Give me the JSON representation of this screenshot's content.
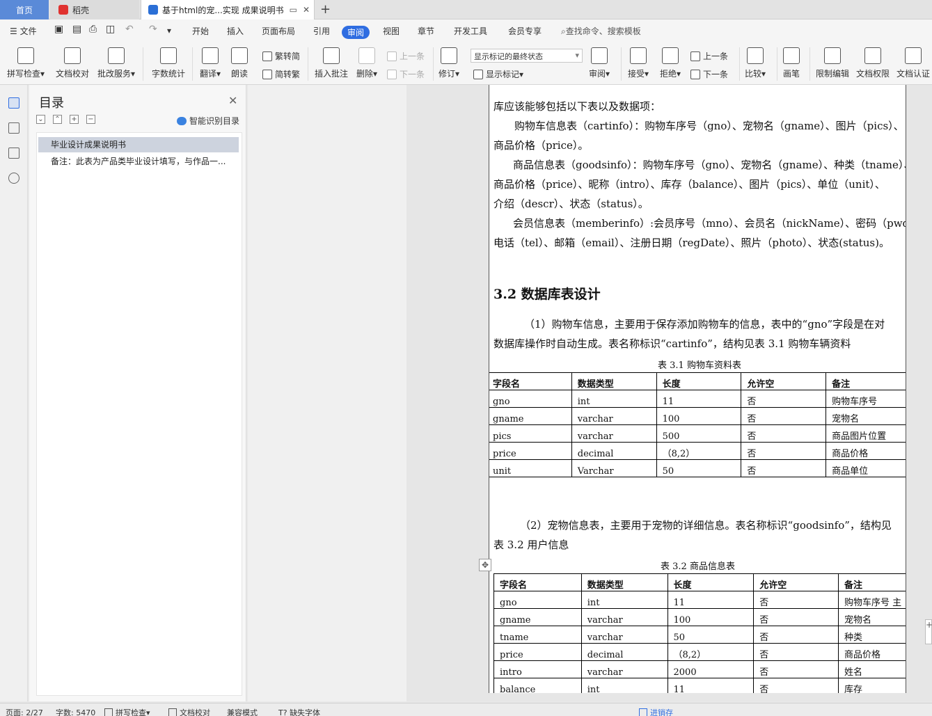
{
  "tabs": {
    "home": "首页",
    "daoke": "稻壳",
    "document": "基于html的宠...实现 成果说明书",
    "add": "+"
  },
  "menu": [
    "文件",
    "开始",
    "插入",
    "页面布局",
    "引用",
    "审阅",
    "视图",
    "章节",
    "开发工具",
    "会员专享"
  ],
  "menu_search": "查找命令、搜索模板",
  "ribbon": {
    "spell_check": "拼写检查",
    "doc_proof": "文档校对",
    "correction_service": "批改服务",
    "word_count": "字数统计",
    "translate": "翻译",
    "read_aloud": "朗读",
    "trad_simp": "繁转简",
    "simp_trad": "简转繁",
    "insert_comment": "插入批注",
    "delete": "删除",
    "prev_item": "上一条",
    "next_item": "下一条",
    "track_changes": "修订",
    "markup_state": "显示标记的最终状态",
    "show_markup": "显示标记",
    "review": "审阅",
    "accept": "接受",
    "reject": "拒绝",
    "prev_change": "上一条",
    "next_change": "下一条",
    "compare": "比较",
    "pen": "画笔",
    "restrict_edit": "限制编辑",
    "doc_permission": "文档权限",
    "doc_cert": "文档认证"
  },
  "toc": {
    "title": "目录",
    "smart_toc": "智能识别目录",
    "items": [
      "毕业设计成果说明书",
      "备注：此表为产品类毕业设计填写，与作品一..."
    ]
  },
  "doc": {
    "lines": [
      "库应该能够包括以下表以及数据项：",
      "购物车信息表（cartinfo）：购物车序号（gno）、宠物名（gname）、图片（pics）、",
      "商品价格（price）。",
      "商品信息表（goodsinfo）：购物车序号（gno）、宠物名（gname）、种类（tname）、",
      "商品价格（price）、昵称（intro）、库存（balance）、图片（pics）、单位（unit）、",
      "介绍（descr）、状态（status）。",
      "会员信息表（memberinfo）:会员序号（mno）、会员名（nickName）、密码（pwd）、",
      "电话（tel）、邮箱（email）、注册日期（regDate）、照片（photo）、状态(status)。"
    ],
    "heading": "3.2 数据库表设计",
    "para1_l1": "（1）购物车信息，主要用于保存添加购物车的信息，表中的“gno”字段是在对",
    "para1_l2": "数据库操作时自动生成。表名称标识“cartinfo”，结构见表 3.1 购物车辆资料",
    "table1_caption": "表 3.1 购物车资料表",
    "table_headers": [
      "字段名",
      "数据类型",
      "长度",
      "允许空",
      "备注"
    ],
    "table1_rows": [
      [
        "gno",
        "int",
        "11",
        "否",
        "购物车序号"
      ],
      [
        "gname",
        "varchar",
        "100",
        "否",
        "宠物名"
      ],
      [
        "pics",
        "varchar",
        "500",
        "否",
        "商品图片位置"
      ],
      [
        "price",
        "decimal",
        "（8,2）",
        "否",
        "商品价格"
      ],
      [
        "unit",
        "Varchar",
        "50",
        "否",
        "商品单位"
      ]
    ],
    "para2_l1": "（2）宠物信息表，主要用于宠物的详细信息。表名称标识“goodsinfo”，结构见",
    "para2_l2": "表 3.2 用户信息",
    "table2_caption": "表 3.2 商品信息表",
    "table2_rows": [
      [
        "gno",
        "int",
        "11",
        "否",
        "购物车序号 主"
      ],
      [
        "gname",
        "varchar",
        "100",
        "否",
        "宠物名"
      ],
      [
        "tname",
        "varchar",
        "50",
        "否",
        "种类"
      ],
      [
        "price",
        "decimal",
        "（8,2）",
        "否",
        "商品价格"
      ],
      [
        "intro",
        "varchar",
        "2000",
        "否",
        "姓名"
      ],
      [
        "balance",
        "int",
        "11",
        "否",
        "库存"
      ]
    ]
  },
  "status": {
    "page": "页面: 2/27",
    "words": "字数: 5470",
    "spell": "拼写检查",
    "proof": "文档校对",
    "compat": "兼容模式",
    "missing_font": "缺失字体",
    "promo": "进销存"
  }
}
